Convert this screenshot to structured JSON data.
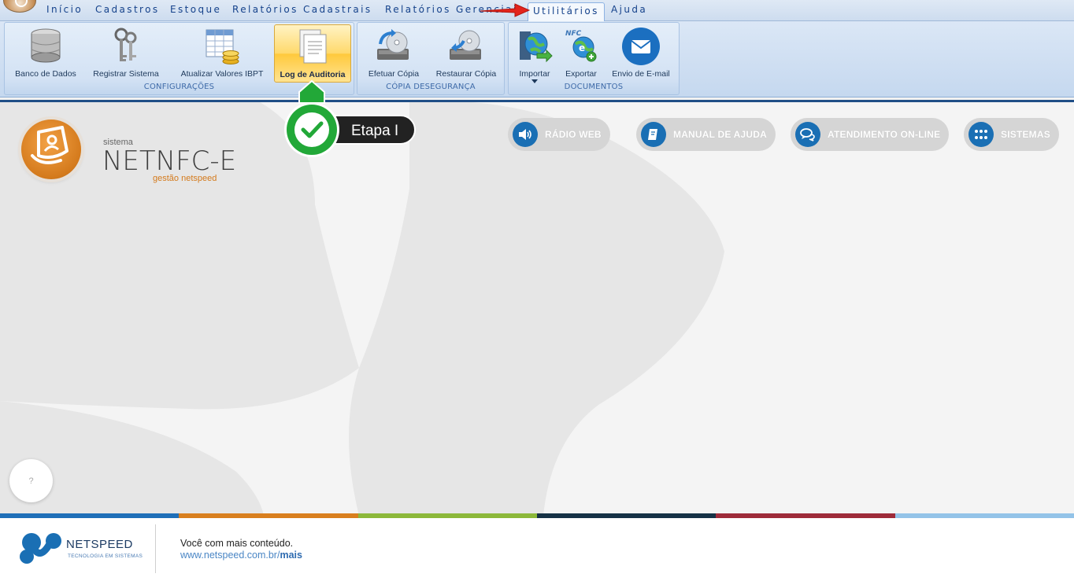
{
  "menu": {
    "tabs": [
      {
        "label": "Início"
      },
      {
        "label": "Cadastros"
      },
      {
        "label": "Estoque"
      },
      {
        "label": "Relatórios Cadastrais"
      },
      {
        "label": "Relatórios Gerenciais"
      },
      {
        "label": "Utilitários",
        "active": true
      },
      {
        "label": "Ajuda"
      }
    ]
  },
  "ribbon": {
    "groups": [
      {
        "label": "CONFIGURAÇÕES",
        "buttons": [
          {
            "label": "Banco de Dados",
            "icon": "database-icon"
          },
          {
            "label": "Registrar Sistema",
            "icon": "keys-icon"
          },
          {
            "label": "Atualizar Valores IBPT",
            "icon": "spreadsheet-coins-icon"
          },
          {
            "label": "Log de Auditoria",
            "icon": "document-log-icon",
            "selected": true
          }
        ]
      },
      {
        "label": "CÓPIA DESEGURANÇA",
        "buttons": [
          {
            "label": "Efetuar Cópia",
            "icon": "backup-disc-icon"
          },
          {
            "label": "Restaurar Cópia",
            "icon": "restore-disc-icon"
          }
        ]
      },
      {
        "label": "DOCUMENTOS",
        "buttons": [
          {
            "label": "Importar",
            "icon": "import-globe-icon"
          },
          {
            "label": "Exportar",
            "icon": "export-nfc-icon"
          },
          {
            "label": "Envio de E-mail",
            "icon": "email-icon"
          }
        ]
      }
    ]
  },
  "brand": {
    "sistema": "sistema",
    "name": "NETNFC-E",
    "tagline": "gestão netspeed"
  },
  "quick_links": [
    {
      "label": "RÁDIO WEB",
      "icon": "speaker-icon"
    },
    {
      "label": "MANUAL DE AJUDA",
      "icon": "book-icon"
    },
    {
      "label": "ATENDIMENTO ON-LINE",
      "icon": "chat-icon"
    },
    {
      "label": "SISTEMAS",
      "icon": "grid-dots-icon"
    }
  ],
  "help": {
    "label": "?"
  },
  "annotation": {
    "label": "Etapa I",
    "icon": "checkmark-icon"
  },
  "footer": {
    "company": "NETSPEED",
    "company_sub": "TECNOLOGIA EM SISTEMAS",
    "line1": "Você com mais conteúdo.",
    "link_prefix": "www.netspeed.com.br/",
    "link_bold": "mais"
  },
  "colors": {
    "accent_blue": "#1a6fb4",
    "brand_orange": "#d47a1c",
    "annotation_green": "#22a838",
    "strip": [
      "#1f6fb8",
      "#d97f1e",
      "#8cb83a",
      "#163246",
      "#9e2b3a",
      "#93c3e8"
    ]
  }
}
